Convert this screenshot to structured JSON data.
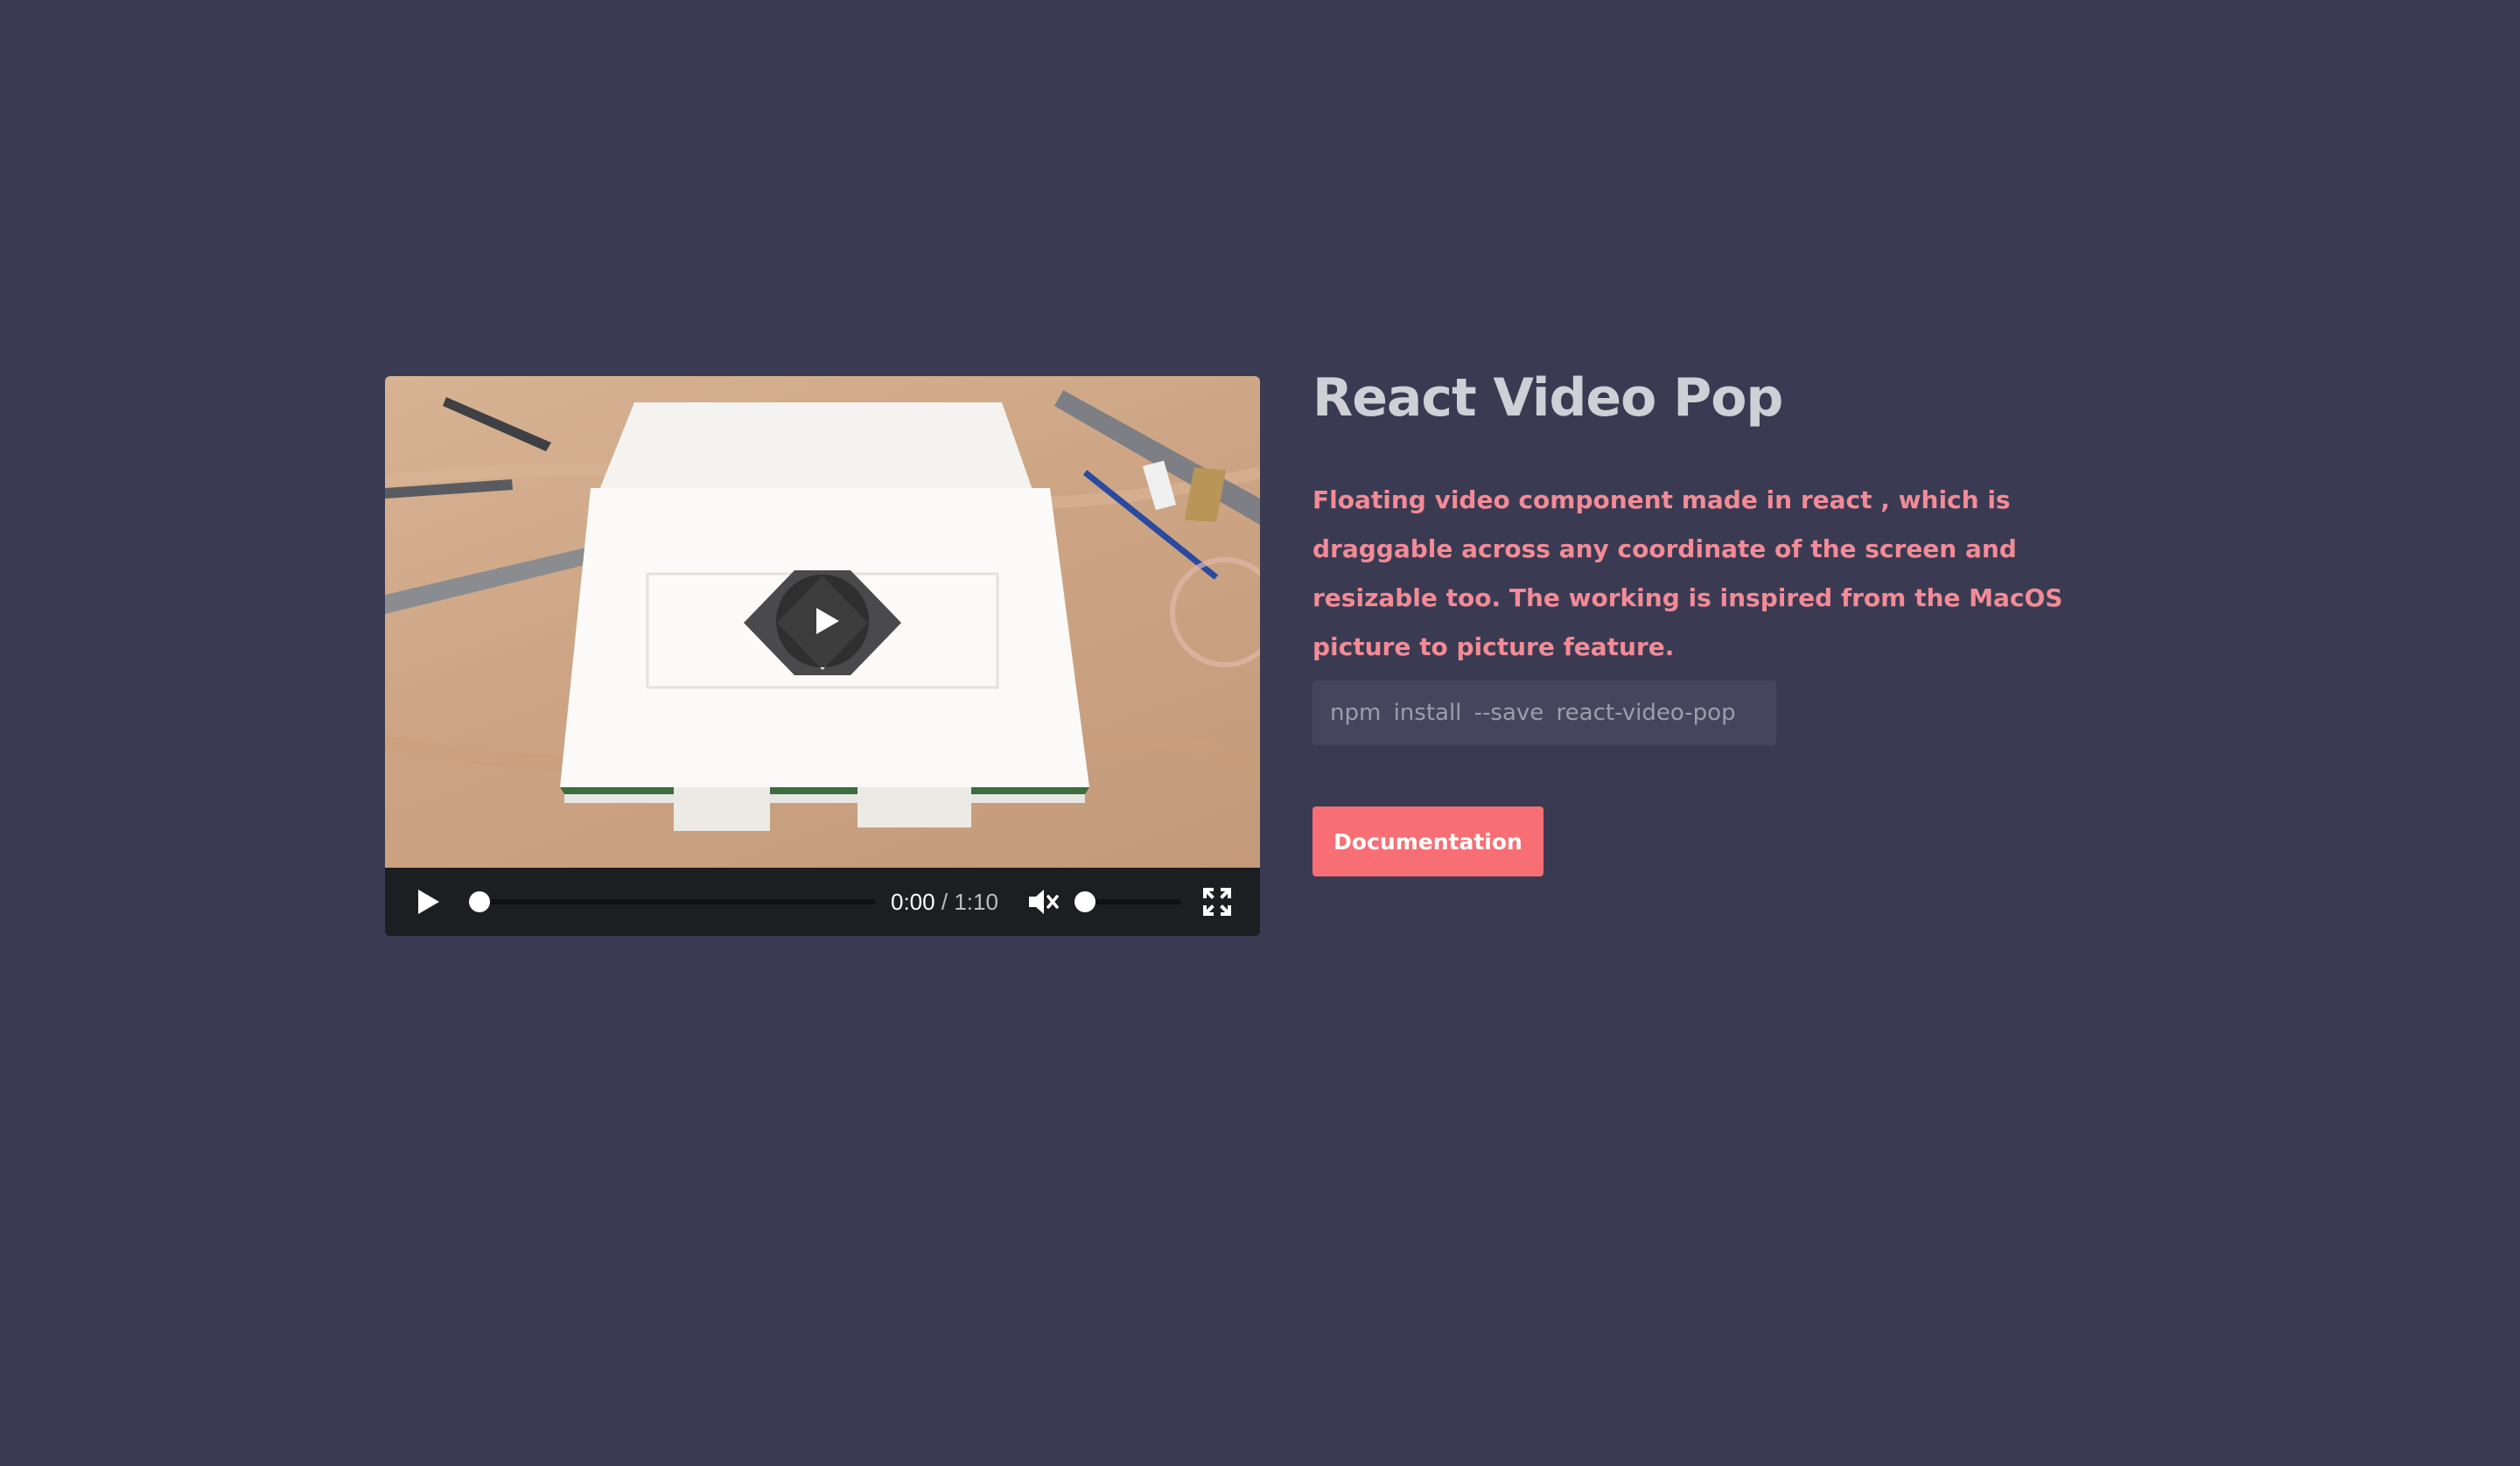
{
  "player": {
    "current_time": "0:00",
    "separator": "/",
    "duration": "1:10",
    "progress": 0,
    "volume": 0,
    "muted": true,
    "icons": {
      "play": "play-icon",
      "big_play": "play-icon",
      "mute": "volume-muted-icon",
      "fullscreen": "fullscreen-icon"
    }
  },
  "info": {
    "title": "React Video Pop",
    "description": "Floating video component made in react , which is draggable across any coordinate of the screen and resizable too. The working is inspired from the MacOS picture to picture feature.",
    "install_command": "npm install --save react-video-pop",
    "doc_button_label": "Documentation"
  },
  "colors": {
    "background": "#3a3b53",
    "title": "#cfcfd6",
    "description": "#f38b96",
    "install_bg": "#45465e",
    "install_text": "#9d9dab",
    "button_bg": "#f76f74",
    "controls_bg": "#1d1e22"
  }
}
